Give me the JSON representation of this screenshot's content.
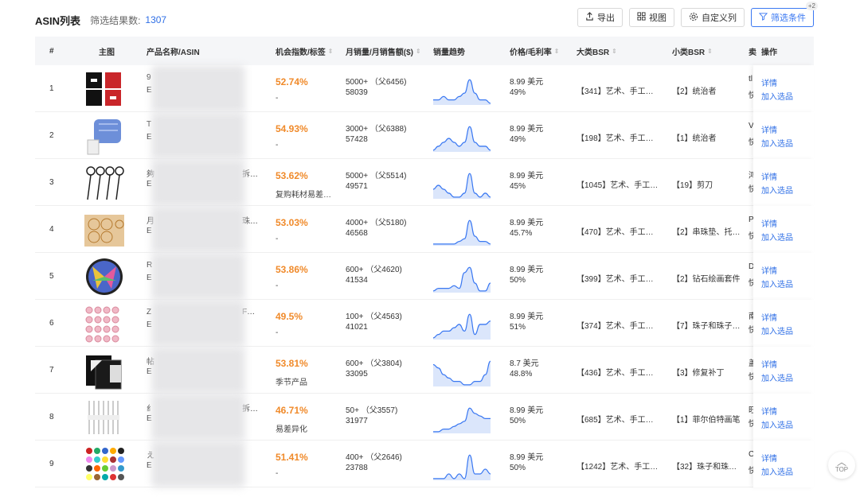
{
  "header": {
    "title": "ASIN列表",
    "count_label": "筛选结果数:",
    "count_value": "1307",
    "actions": [
      {
        "label": "导出",
        "icon": "export-icon"
      },
      {
        "label": "视图",
        "icon": "grid-icon"
      },
      {
        "label": "自定义列",
        "icon": "gear-icon"
      },
      {
        "label": "筛选条件",
        "icon": "filter-icon",
        "badge": "+2"
      }
    ]
  },
  "columns": [
    "#",
    "主图",
    "产品名称/ASIN",
    "机会指数/标签",
    "月销量/月销售额($)",
    "销量趋势",
    "价格/毛利率",
    "大类BSR",
    "小类BSR",
    "卖",
    "操作"
  ],
  "ops": {
    "detail": "详情",
    "add": "加入选品"
  },
  "rows": [
    {
      "idx": "1",
      "name_prefix": "9",
      "asin_prefix": "E",
      "name_suffix": "",
      "chance": "52.74%",
      "tag": "-",
      "sales": "5000+ （父6456)",
      "revenue": "58039",
      "price": "8.99 美元",
      "margin": "49%",
      "bsr_main": "【341】艺术、手工…",
      "bsr_sub": "【2】统治者",
      "seller_a": "tl",
      "seller_b": "快",
      "trend": [
        3,
        3,
        4,
        3,
        3,
        4,
        5,
        9,
        5,
        3,
        3,
        2
      ]
    },
    {
      "idx": "2",
      "name_prefix": "T",
      "asin_prefix": "E",
      "name_suffix": "",
      "chance": "54.93%",
      "tag": "-",
      "sales": "3000+ （父6388)",
      "revenue": "57428",
      "price": "8.99 美元",
      "margin": "49%",
      "bsr_main": "【198】艺术、手工…",
      "bsr_sub": "【1】统治者",
      "seller_a": "Ve",
      "seller_b": "快",
      "trend": [
        3,
        4,
        5,
        6,
        5,
        4,
        5,
        9,
        5,
        4,
        4,
        3
      ]
    },
    {
      "idx": "3",
      "name_prefix": "夠",
      "asin_prefix": "E",
      "name_suffix": "拆…",
      "chance": "53.62%",
      "tag": "复购耗材易差…",
      "sales": "5000+ （父5514)",
      "revenue": "49571",
      "price": "8.99 美元",
      "margin": "45%",
      "bsr_main": "【1045】艺术、手工…",
      "bsr_sub": "【19】剪刀",
      "seller_a": "鸿",
      "seller_b": "快",
      "trend": [
        5,
        6,
        5,
        4,
        3,
        3,
        4,
        9,
        4,
        3,
        4,
        3
      ]
    },
    {
      "idx": "4",
      "name_prefix": "月",
      "asin_prefix": "E",
      "name_suffix": "珠…",
      "chance": "53.03%",
      "tag": "-",
      "sales": "4000+ （父5180)",
      "revenue": "46568",
      "price": "8.99 美元",
      "margin": "45.7%",
      "bsr_main": "【470】艺术、手工…",
      "bsr_sub": "【2】串珠垫、托…",
      "seller_a": "Pe",
      "seller_b": "快",
      "trend": [
        1,
        1,
        1,
        1,
        1,
        2,
        3,
        10,
        4,
        2,
        2,
        1
      ]
    },
    {
      "idx": "5",
      "name_prefix": "R",
      "asin_prefix": "E",
      "name_suffix": "",
      "chance": "53.86%",
      "tag": "-",
      "sales": "600+ （父4620)",
      "revenue": "41534",
      "price": "8.99 美元",
      "margin": "50%",
      "bsr_main": "【399】艺术、手工…",
      "bsr_sub": "【2】钻石绘画套件",
      "seller_a": "D",
      "seller_b": "快",
      "trend": [
        1,
        2,
        2,
        2,
        3,
        2,
        8,
        10,
        4,
        1,
        1,
        4
      ]
    },
    {
      "idx": "6",
      "name_prefix": "Z",
      "asin_prefix": "E",
      "name_suffix": "F…",
      "chance": "49.5%",
      "tag": "-",
      "sales": "100+ （父4563)",
      "revenue": "41021",
      "price": "8.99 美元",
      "margin": "51%",
      "bsr_main": "【374】艺术、手工…",
      "bsr_sub": "【7】珠子和珠子…",
      "seller_a": "南",
      "seller_b": "快",
      "trend": [
        2,
        3,
        4,
        4,
        5,
        6,
        4,
        9,
        3,
        6,
        6,
        7
      ]
    },
    {
      "idx": "7",
      "name_prefix": "帖",
      "asin_prefix": "E",
      "name_suffix": "",
      "chance": "53.81%",
      "tag": "季节产品",
      "sales": "600+ （父3804)",
      "revenue": "33095",
      "price": "8.7 美元",
      "margin": "48.8%",
      "bsr_main": "【436】艺术、手工…",
      "bsr_sub": "【3】修复补丁",
      "seller_a": "盖",
      "seller_b": "快",
      "trend": [
        8,
        7,
        5,
        4,
        3,
        3,
        2,
        2,
        3,
        3,
        5,
        9
      ]
    },
    {
      "idx": "8",
      "name_prefix": "纟",
      "asin_prefix": "E",
      "name_suffix": "拆…",
      "chance": "46.71%",
      "tag": "易差异化",
      "sales": "50+ （父3557)",
      "revenue": "31977",
      "price": "8.99 美元",
      "margin": "50%",
      "bsr_main": "【685】艺术、手工…",
      "bsr_sub": "【1】菲尔伯特画笔",
      "seller_a": "旺",
      "seller_b": "快",
      "trend": [
        1,
        1,
        2,
        2,
        3,
        4,
        5,
        10,
        8,
        7,
        6,
        6
      ]
    },
    {
      "idx": "9",
      "name_prefix": "え",
      "asin_prefix": "E",
      "name_suffix": "",
      "chance": "51.41%",
      "tag": "-",
      "sales": "400+ （父2646)",
      "revenue": "23788",
      "price": "8.99 美元",
      "margin": "50%",
      "bsr_main": "【1242】艺术、手工…",
      "bsr_sub": "【32】珠子和珠…",
      "seller_a": "C",
      "seller_b": "快",
      "trend": [
        3,
        3,
        3,
        4,
        3,
        4,
        3,
        8,
        4,
        4,
        5,
        4
      ]
    }
  ],
  "scroll_top": "TOP",
  "colors": {
    "accent": "#2f6fe6",
    "chance": "#f08a2a",
    "spark_line": "#3a78f2",
    "spark_fill": "#dbe6fb"
  }
}
